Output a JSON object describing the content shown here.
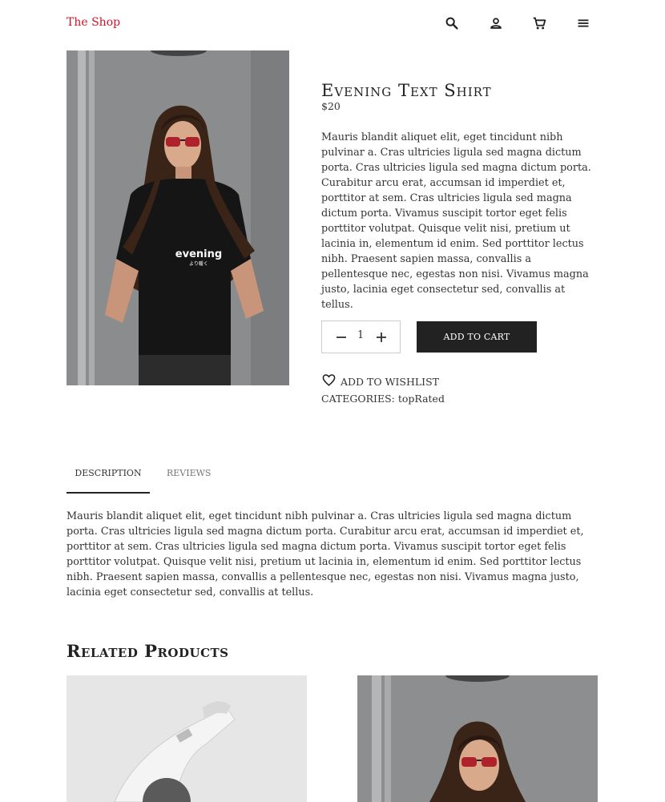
{
  "header": {
    "brand": "The Shop",
    "icons": [
      "search-icon",
      "user-icon",
      "cart-icon",
      "menu-icon"
    ]
  },
  "product": {
    "title": "Evening Text Shirt",
    "price": "$20",
    "short_description": "Mauris blandit aliquet elit, eget tincidunt nibh pulvinar a. Cras ultricies ligula sed magna dictum porta. Cras ultricies ligula sed magna dictum porta. Curabitur arcu erat, accumsan id imperdiet et, porttitor at sem. Cras ultricies ligula sed magna dictum porta. Vivamus suscipit tortor eget felis porttitor volutpat. Quisque velit nisi, pretium ut lacinia in, elementum id enim. Sed porttitor lectus nibh. Praesent sapien massa, convallis a pellentesque nec, egestas non nisi. Vivamus magna justo, lacinia eget consectetur sed, convallis at tellus.",
    "quantity": "1",
    "add_to_cart_label": "ADD TO CART",
    "wishlist_label": "ADD TO WISHLIST",
    "categories": "CATEGORIES: topRated",
    "shirt_print": "evening",
    "shirt_print_sub": "より暖く"
  },
  "tabs": {
    "description_label": "DESCRIPTION",
    "reviews_label": "REVIEWS"
  },
  "long_description": "Mauris blandit aliquet elit, eget tincidunt nibh pulvinar a. Cras ultricies ligula sed magna dictum porta. Cras ultricies ligula sed magna dictum porta. Curabitur arcu erat, accumsan id imperdiet et, porttitor at sem. Cras ultricies ligula sed magna dictum porta. Vivamus suscipit tortor eget felis porttitor volutpat. Quisque velit nisi, pretium ut lacinia in, elementum id enim. Sed porttitor lectus nibh. Praesent sapien massa, convallis a pellentesque nec, egestas non nisi. Vivamus magna justo, lacinia eget consectetur sed, convallis at tellus.",
  "related": {
    "title": "Related Products"
  },
  "colors": {
    "brand": "#d0142c",
    "button": "#222222"
  }
}
